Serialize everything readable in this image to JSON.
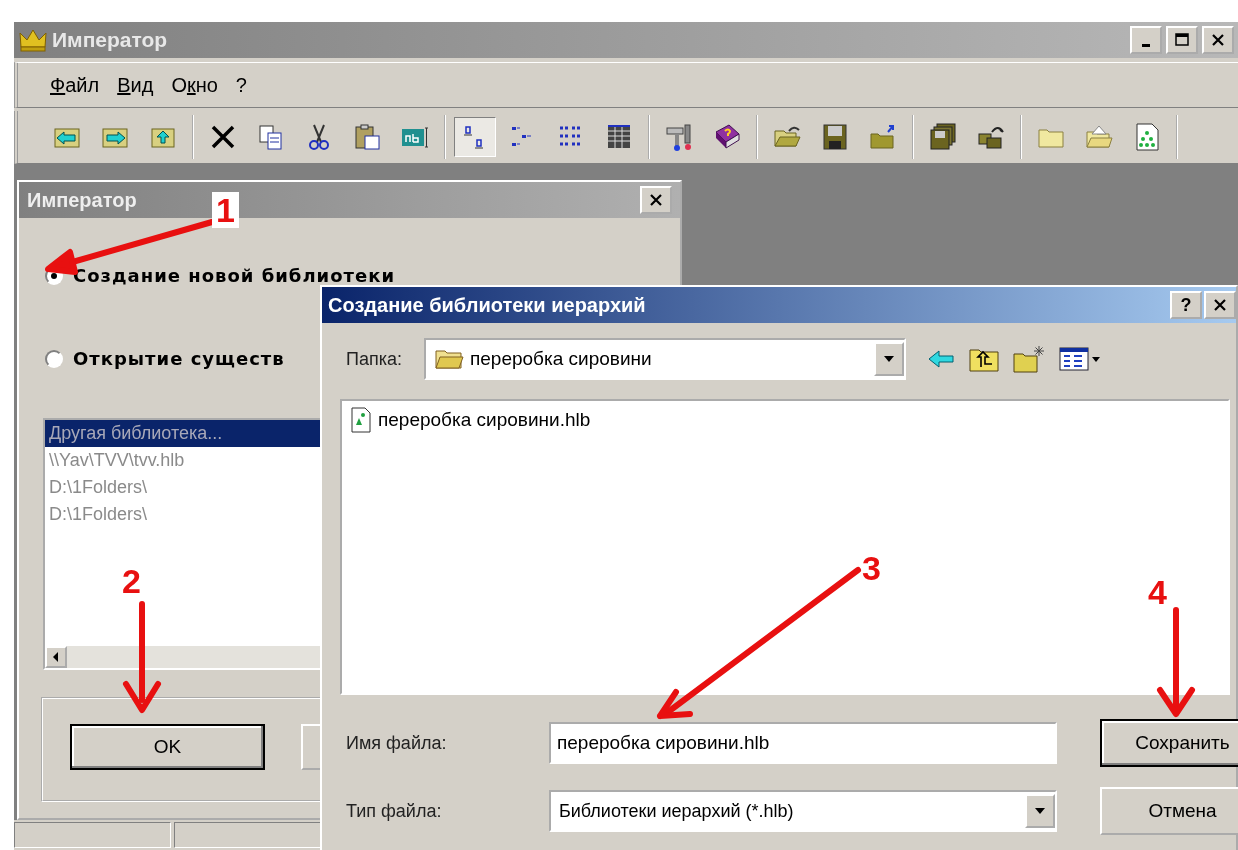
{
  "window": {
    "title": "Император"
  },
  "menu": [
    {
      "key": "Ф",
      "after": "айл"
    },
    {
      "key": "В",
      "after": "ид"
    },
    {
      "before": "О",
      "key": "к",
      "after": "но"
    },
    {
      "before": "?"
    }
  ],
  "toolbar": [
    [
      {
        "kind": "back",
        "pressed": false
      },
      {
        "kind": "forward",
        "pressed": false
      },
      {
        "kind": "up",
        "pressed": false
      }
    ],
    [
      {
        "kind": "delete",
        "pressed": false
      },
      {
        "kind": "copy",
        "pressed": false
      },
      {
        "kind": "cut",
        "pressed": false
      },
      {
        "kind": "paste",
        "pressed": false
      },
      {
        "kind": "rename",
        "pressed": false
      }
    ],
    [
      {
        "kind": "level",
        "pressed": true
      },
      {
        "kind": "branch",
        "pressed": false
      },
      {
        "kind": "list",
        "pressed": false
      },
      {
        "kind": "grid",
        "pressed": false
      }
    ],
    [
      {
        "kind": "tools",
        "pressed": false
      },
      {
        "kind": "helpbook",
        "pressed": false
      }
    ],
    [
      {
        "kind": "open",
        "pressed": false
      },
      {
        "kind": "save",
        "pressed": false
      },
      {
        "kind": "folderup",
        "pressed": false
      }
    ],
    [
      {
        "kind": "disks",
        "pressed": false
      },
      {
        "kind": "restore",
        "pressed": false
      }
    ],
    [
      {
        "kind": "folder",
        "pressed": false
      },
      {
        "kind": "folderopen",
        "pressed": false
      },
      {
        "kind": "document",
        "pressed": false
      }
    ]
  ],
  "wizard": {
    "title": "Император",
    "options": [
      {
        "label": "Создание новой библиотеки",
        "selected": true
      },
      {
        "label": "Открытие существ",
        "selected": false
      }
    ],
    "libraries": [
      {
        "text": "Другая библиотека...",
        "selected": true
      },
      {
        "text": "\\\\Yav\\TVV\\tvv.hlb",
        "selected": false
      },
      {
        "text": "D:\\1Folders\\",
        "selected": false
      },
      {
        "text": "D:\\1Folders\\",
        "selected": false
      }
    ],
    "ok_button": "OK"
  },
  "save_dialog": {
    "title": "Создание библиотеки иерархий",
    "help_button": "?",
    "folder_label": "Папка:",
    "folder": "переробка сировини",
    "files": [
      {
        "name": "переробка сировини.hlb"
      }
    ],
    "file_name_label": "Имя файла:",
    "file_name": "переробка сировини.hlb",
    "file_type_label": "Тип файла:",
    "file_type": "Библиотеки иерархий (*.hlb)",
    "save_button": "Сохранить",
    "cancel_button": "Отмена"
  },
  "annotations": [
    {
      "number": "1"
    },
    {
      "number": "2"
    },
    {
      "number": "3"
    },
    {
      "number": "4"
    }
  ]
}
